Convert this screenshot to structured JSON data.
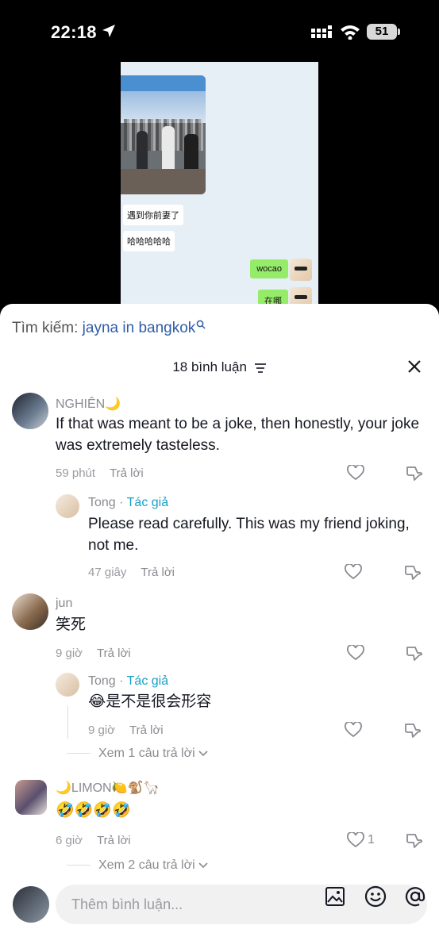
{
  "status_bar": {
    "time": "22:18",
    "battery": "51"
  },
  "video": {
    "messages_left": [
      "遇到你前妻了",
      "哈哈哈哈哈"
    ],
    "messages_right": [
      "wocao",
      "在哪"
    ]
  },
  "search": {
    "label": "Tìm kiếm:",
    "query": "jayna in bangkok"
  },
  "comments_header": {
    "count_label": "18 bình luận"
  },
  "comments": [
    {
      "author": "NGHIÊN🌙",
      "text": "If that was meant to be a joke, then honestly, your joke was extremely tasteless.",
      "time": "59 phút",
      "reply_label": "Trả lời"
    },
    {
      "author": "Tong",
      "author_badge": "Tác giả",
      "text": "Please read carefully. This was my friend joking, not me.",
      "time": "47 giây",
      "reply_label": "Trả lời"
    },
    {
      "author": "jun",
      "text": "笑死",
      "time": "9 giờ",
      "reply_label": "Trả lời"
    },
    {
      "author": "Tong",
      "author_badge": "Tác giả",
      "text": "😂是不是很会形容",
      "time": "9 giờ",
      "reply_label": "Trả lời"
    },
    {
      "author": "🌙LIMON🍋🐒🦙",
      "text": "🤣🤣🤣🤣",
      "time": "6 giờ",
      "reply_label": "Trả lời",
      "likes": "1"
    }
  ],
  "view_replies": [
    "Xem 1 câu trả lời",
    "Xem 2 câu trả lời"
  ],
  "input": {
    "placeholder": "Thêm bình luận..."
  },
  "colors": {
    "author_badge": "#18a0c8",
    "search_query": "#2f5ca8",
    "wechat_green": "#95ec69"
  }
}
